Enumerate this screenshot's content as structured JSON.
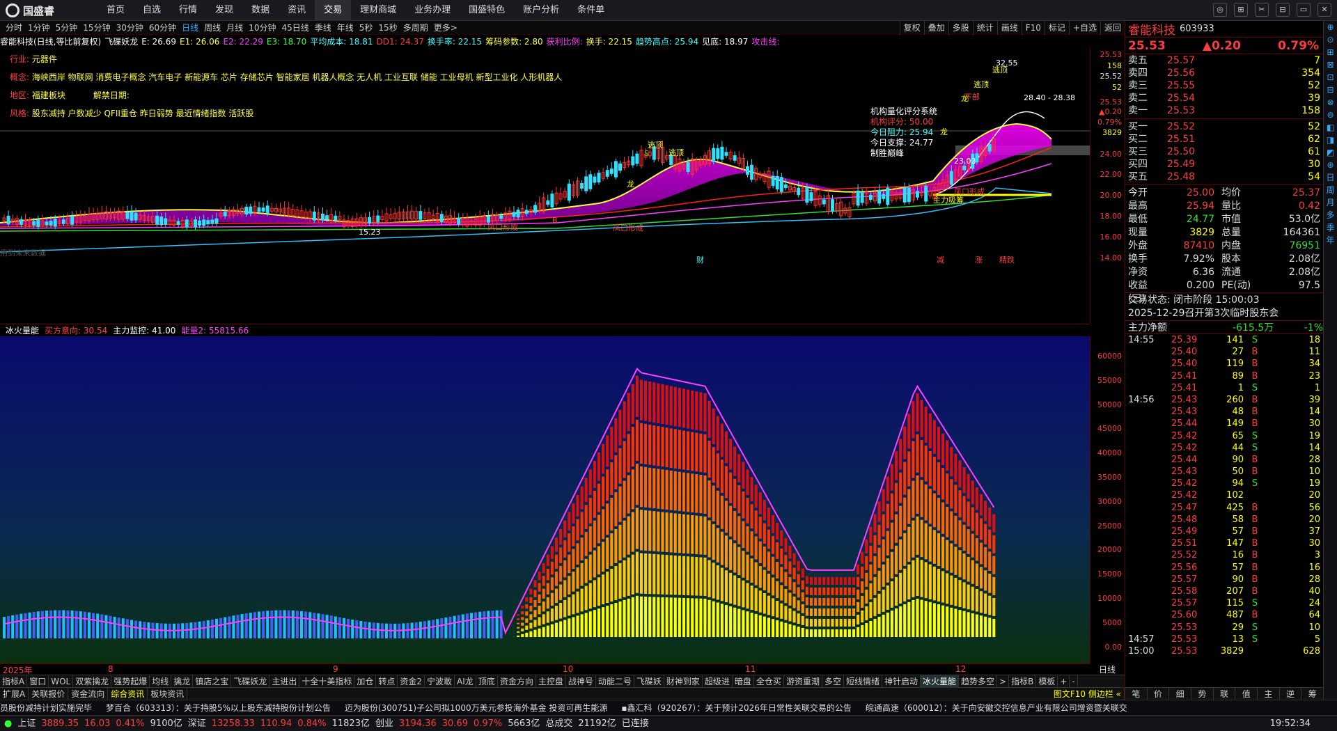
{
  "app": {
    "name": "国盛睿"
  },
  "nav": [
    "首页",
    "自选",
    "行情",
    "发现",
    "数据",
    "资讯",
    "交易",
    "理财商城",
    "业务办理",
    "国盛特色",
    "账户分析",
    "条件单"
  ],
  "nav_active": 6,
  "window_btns": [
    "◎",
    "⊞",
    "✂",
    "⊟",
    "▭",
    "✕"
  ],
  "periods": [
    "分时",
    "1分钟",
    "5分钟",
    "15分钟",
    "30分钟",
    "60分钟",
    "日线",
    "周线",
    "月线",
    "10分钟",
    "45日线",
    "季线",
    "年线",
    "5秒",
    "15秒",
    "多周期",
    "更多>"
  ],
  "period_active": 6,
  "right_tools": [
    "复权",
    "叠加",
    "多股",
    "统计",
    "画线",
    "F10",
    "标记",
    "+自选",
    "返回"
  ],
  "indicator_bar": [
    {
      "t": "睿能科技(日线,等比前复权)",
      "c": "#ffffff"
    },
    {
      "t": "飞碟妖龙",
      "c": "#ffffff"
    },
    {
      "t": "E: 26.69",
      "c": "#ffffff"
    },
    {
      "t": "E1: 26.06",
      "c": "#ffff40"
    },
    {
      "t": "E2: 22.29",
      "c": "#ff40ff"
    },
    {
      "t": "E3: 18.70",
      "c": "#40ff40"
    },
    {
      "t": "平均成本: 18.81",
      "c": "#40ffff"
    },
    {
      "t": "DD1: 24.37",
      "c": "#ff4040"
    },
    {
      "t": "换手率: 22.15",
      "c": "#40ffff"
    },
    {
      "t": "筹码参数: 2.80",
      "c": "#ffff40"
    },
    {
      "t": "获利比例:",
      "c": "#ff40ff"
    },
    {
      "t": "换手: 22.15",
      "c": "#ffff40"
    },
    {
      "t": "趋势高点: 25.94",
      "c": "#40ffff"
    },
    {
      "t": "见底: 18.97",
      "c": "#ffffff"
    },
    {
      "t": "攻击线:",
      "c": "#ff40ff"
    }
  ],
  "info": [
    {
      "label": "行业:",
      "value": "元器件"
    },
    {
      "label": "概念:",
      "value": "海峡西岸 物联网 消费电子概念 汽车电子 新能源车 芯片 存储芯片 智能家居 机器人概念 无人机 工业互联 储能 工业母机 新型工业化 人形机器人"
    },
    {
      "label": "地区:",
      "value": "福建板块",
      "extra": "解禁日期:"
    },
    {
      "label": "风格:",
      "value": "股东减持 户数减少 QFII重仓 昨日弱势 最近情绪指数 活跃股"
    }
  ],
  "inst_box": {
    "title": "机构量化评分系统",
    "score_label": "机构评分:",
    "score": "50.00",
    "res_label": "今日阻力:",
    "res": "25.94",
    "sup_label": "今日支撑:",
    "sup": "24.77",
    "note": "制胜巅峰"
  },
  "chart_labels": [
    "32.55",
    "逃顶",
    "逃顶",
    "28.40 - 28.38",
    "下部",
    "逃顶",
    "逃顶",
    "龙",
    "龙",
    "龙",
    "15.23",
    "凤口形成",
    "凤口形成",
    "凤口形成",
    "主力吸筹",
    "23.02",
    "财",
    "减",
    "涨",
    "精跌",
    "用到未来数据",
    "S",
    "B"
  ],
  "y1": [
    "25.53",
    "158",
    "25.52",
    "52",
    "25.53",
    "▲0.20",
    "0.79%",
    "3829",
    "24.00",
    "22.00",
    "20.00",
    "18.00",
    "16.00",
    "14.00"
  ],
  "sub_header": [
    {
      "t": "冰火量能",
      "c": "#ffffff"
    },
    {
      "t": "买方意向: 30.54",
      "c": "#ff4040"
    },
    {
      "t": "主力监控: 41.00",
      "c": "#ffffff"
    },
    {
      "t": "能量2: 55815.66",
      "c": "#ff40ff"
    }
  ],
  "y2": [
    "60000",
    "55000",
    "50000",
    "45000",
    "40000",
    "35000",
    "30000",
    "25000",
    "20000",
    "15000",
    "10000",
    "5000",
    "0.00"
  ],
  "date_axis": [
    "2025年",
    "8",
    "9",
    "10",
    "11",
    "12"
  ],
  "day_btn": "日线",
  "tabs1": [
    "指标A",
    "窗口",
    "WOL",
    "双紫擒龙",
    "强势起爆",
    "均线",
    "擒龙",
    "镇店之宝",
    "飞碟妖龙",
    "主进出",
    "十全十美指标",
    "加仓",
    "转点",
    "资金2",
    "宁波敢",
    "AI龙",
    "顶底",
    "资金方向",
    "主控盘",
    "战神号",
    "动能二号",
    "飞碟妖",
    "财神到家",
    "超级进",
    "暗盘",
    "全仓买",
    "游资重潮",
    "多空",
    "短线情绪",
    "神针启动",
    "冰火量能",
    "趋势多空",
    ">",
    "指标B",
    "模板",
    "+",
    "-"
  ],
  "tabs1_active": 30,
  "tabs2": [
    "扩展A",
    "关联报价",
    "资金流向",
    "综合资讯",
    "板块资讯"
  ],
  "tabs2_active": 3,
  "tabs2_right": "图文F10 侧边栏 «",
  "news": [
    "员股份减持计划实施完毕",
    "梦百合（603313）：关于持股5%以上股东减持股份计划公告",
    "迈为股份(300751)子公司拟1000万美元参投海外基金 投资可再生能源",
    "▪鑫汇科（920267）：关于预计2026年日常性关联交易的公告",
    "皖通高速（600012）：关于向安徽交控信息产业有限公司增资暨关联交"
  ],
  "status": {
    "sh_label": "上证",
    "sh": "3889.35",
    "sh_ch": "16.03",
    "sh_pct": "0.41%",
    "sh_amt": "9100亿",
    "sz_label": "深证",
    "sz": "13258.33",
    "sz_ch": "110.94",
    "sz_pct": "0.84%",
    "sz_amt": "11823亿",
    "cy_label": "创业",
    "cy": "3194.36",
    "cy_ch": "30.69",
    "cy_pct": "0.97%",
    "cy_amt": "5663亿",
    "tot_label": "总成交",
    "tot": "21192亿",
    "conn": "已连接",
    "time": "19:52:34"
  },
  "stock": {
    "name": "睿能科技",
    "code": "603933",
    "price": "25.53",
    "change": "▲0.20",
    "pct": "0.79%"
  },
  "asks": [
    {
      "n": "卖五",
      "p": "25.57",
      "v": "7"
    },
    {
      "n": "卖四",
      "p": "25.56",
      "v": "354"
    },
    {
      "n": "卖三",
      "p": "25.55",
      "v": "52"
    },
    {
      "n": "卖二",
      "p": "25.54",
      "v": "39"
    },
    {
      "n": "卖一",
      "p": "25.53",
      "v": "158"
    }
  ],
  "bids": [
    {
      "n": "买一",
      "p": "25.52",
      "v": "52"
    },
    {
      "n": "买二",
      "p": "25.51",
      "v": "62"
    },
    {
      "n": "买三",
      "p": "25.50",
      "v": "61"
    },
    {
      "n": "买四",
      "p": "25.49",
      "v": "30"
    },
    {
      "n": "买五",
      "p": "25.48",
      "v": "54"
    }
  ],
  "stats": [
    {
      "k": "今开",
      "a": "25.00",
      "k2": "均价",
      "b": "25.37"
    },
    {
      "k": "最高",
      "a": "25.94",
      "k2": "量比",
      "b": "0.42"
    },
    {
      "k": "最低",
      "a": "24.77",
      "k2": "市值",
      "b": "53.0亿"
    },
    {
      "k": "现量",
      "a": "3829",
      "k2": "总量",
      "b": "164361"
    },
    {
      "k": "外盘",
      "a": "87410",
      "k2": "内盘",
      "b": "76951"
    },
    {
      "k": "换手",
      "a": "7.92%",
      "k2": "股本",
      "b": "2.08亿"
    },
    {
      "k": "净资",
      "a": "6.36",
      "k2": "流通",
      "b": "2.08亿"
    },
    {
      "k": "收益(三)",
      "a": "0.200",
      "k2": "PE(动)",
      "b": "97.5"
    }
  ],
  "trade_state": "交易状态: 闭市阶段 15:00:03",
  "trade_news": "2025-12-29召开第3次临时股东会",
  "netflow": {
    "label": "主力净额",
    "value": "-615.5万",
    "pct": "-1%"
  },
  "ticks": [
    {
      "t": "14:55",
      "p": "25.39",
      "v": "141",
      "d": "S",
      "n": "18"
    },
    {
      "t": "",
      "p": "25.40",
      "v": "27",
      "d": "B",
      "n": "11"
    },
    {
      "t": "",
      "p": "25.40",
      "v": "119",
      "d": "B",
      "n": "34"
    },
    {
      "t": "",
      "p": "25.41",
      "v": "89",
      "d": "B",
      "n": "23"
    },
    {
      "t": "",
      "p": "25.41",
      "v": "1",
      "d": "S",
      "n": "1"
    },
    {
      "t": "14:56",
      "p": "25.43",
      "v": "260",
      "d": "B",
      "n": "39"
    },
    {
      "t": "",
      "p": "25.43",
      "v": "48",
      "d": "B",
      "n": "14"
    },
    {
      "t": "",
      "p": "25.44",
      "v": "149",
      "d": "B",
      "n": "30"
    },
    {
      "t": "",
      "p": "25.42",
      "v": "65",
      "d": "S",
      "n": "19"
    },
    {
      "t": "",
      "p": "25.42",
      "v": "44",
      "d": "S",
      "n": "14"
    },
    {
      "t": "",
      "p": "25.44",
      "v": "90",
      "d": "B",
      "n": "28"
    },
    {
      "t": "",
      "p": "25.43",
      "v": "50",
      "d": "B",
      "n": "10"
    },
    {
      "t": "",
      "p": "25.42",
      "v": "94",
      "d": "S",
      "n": "19"
    },
    {
      "t": "",
      "p": "25.42",
      "v": "102",
      "d": "",
      "n": "20"
    },
    {
      "t": "",
      "p": "25.47",
      "v": "425",
      "d": "B",
      "n": "56"
    },
    {
      "t": "",
      "p": "25.48",
      "v": "58",
      "d": "B",
      "n": "20"
    },
    {
      "t": "",
      "p": "25.49",
      "v": "57",
      "d": "B",
      "n": "37"
    },
    {
      "t": "",
      "p": "25.51",
      "v": "147",
      "d": "B",
      "n": "30"
    },
    {
      "t": "",
      "p": "25.52",
      "v": "16",
      "d": "B",
      "n": "3"
    },
    {
      "t": "",
      "p": "25.56",
      "v": "57",
      "d": "B",
      "n": "16"
    },
    {
      "t": "",
      "p": "25.57",
      "v": "90",
      "d": "B",
      "n": "28"
    },
    {
      "t": "",
      "p": "25.58",
      "v": "207",
      "d": "B",
      "n": "40"
    },
    {
      "t": "",
      "p": "25.57",
      "v": "115",
      "d": "S",
      "n": "24"
    },
    {
      "t": "",
      "p": "25.60",
      "v": "487",
      "d": "B",
      "n": "64"
    },
    {
      "t": "",
      "p": "25.53",
      "v": "29",
      "d": "S",
      "n": "10"
    },
    {
      "t": "14:57",
      "p": "25.53",
      "v": "13",
      "d": "S",
      "n": "5"
    },
    {
      "t": "15:00",
      "p": "25.53",
      "v": "3829",
      "d": "",
      "n": "628"
    }
  ],
  "right_tabs": [
    "笔",
    "价",
    "细",
    "势",
    "联",
    "值",
    "主",
    "逆",
    "筹"
  ],
  "vstrip": [
    "⊕",
    "⊙",
    "⊞",
    "⊠",
    "⊡",
    "⊟",
    "⊗",
    "⊚",
    "◧",
    "◨",
    "◩",
    "⊛",
    "日",
    "周",
    "月",
    "多",
    "季",
    "年"
  ]
}
